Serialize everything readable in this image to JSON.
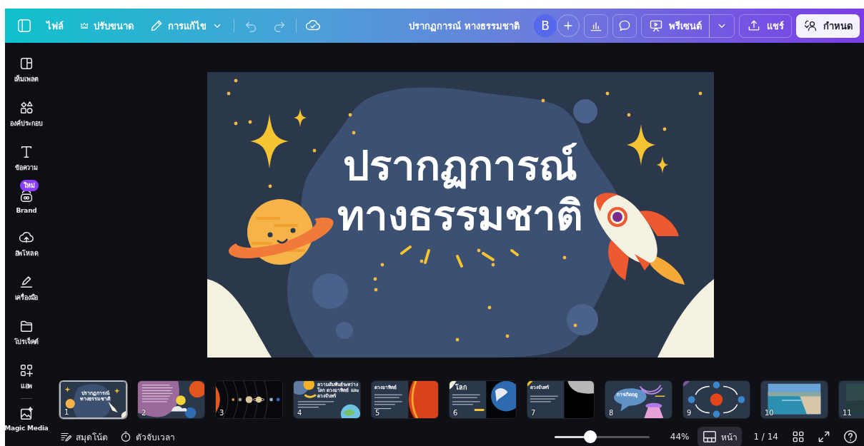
{
  "toolbar": {
    "menu": [
      {
        "label": "ไฟล์",
        "kind": "file"
      },
      {
        "label": "ปรับขนาด",
        "kind": "resize"
      },
      {
        "label": "การแก้ไข",
        "kind": "edit"
      }
    ],
    "title": "ปรากฏการณ์ ทางธรรมชาติ",
    "avatar": "B",
    "present": "พรีเซนต์",
    "share": "แชร์",
    "customize": "กำหนด"
  },
  "sidebar": {
    "items": [
      {
        "label": "เท็มเพลต",
        "kind": "template"
      },
      {
        "label": "องค์ประกอบ",
        "kind": "elements"
      },
      {
        "label": "ข้อความ",
        "kind": "text"
      },
      {
        "label": "Brand",
        "kind": "brand",
        "badge": "ใหม่"
      },
      {
        "label": "อัพโหลด",
        "kind": "upload"
      },
      {
        "label": "เครื่องมือ",
        "kind": "draw"
      },
      {
        "label": "โปรเจ็คต์",
        "kind": "folder"
      },
      {
        "label": "แอพ",
        "kind": "apps"
      },
      {
        "label": "Magic Media",
        "kind": "magic"
      }
    ]
  },
  "slide": {
    "title_lines": [
      "ปรากฏการณ์",
      "ทางธรรมชาติ"
    ]
  },
  "pages": [
    {
      "number": "1",
      "selected": true,
      "kind": "cover",
      "title": "ปรากฏการณ์ ทางธรรมชาติ"
    },
    {
      "number": "2",
      "selected": false,
      "kind": "text-space"
    },
    {
      "number": "3",
      "selected": false,
      "kind": "solar"
    },
    {
      "number": "4",
      "selected": false,
      "kind": "relation",
      "title": "ความสัมพันธ์ระหว่างโลก ดวงอาทิตย์ และดวงจันทร์"
    },
    {
      "number": "5",
      "selected": false,
      "kind": "sun",
      "title": "ดวงอาทิตย์"
    },
    {
      "number": "6",
      "selected": false,
      "kind": "earth",
      "title": "โลก"
    },
    {
      "number": "7",
      "selected": false,
      "kind": "moon",
      "title": "ดวงจันทร์"
    },
    {
      "number": "8",
      "selected": false,
      "kind": "season",
      "title": "การเกิดฤดู"
    },
    {
      "number": "9",
      "selected": false,
      "kind": "orbit"
    },
    {
      "number": "10",
      "selected": false
    },
    {
      "number": "11",
      "selected": false,
      "kind": "photo-dark"
    }
  ],
  "footer": {
    "notes": "สมุดโน้ต",
    "timer": "ตัวจับเวลา",
    "zoom": {
      "level": 0.39
    },
    "zoom_text": "44%",
    "view": "หน้า",
    "page_count": "1 / 14"
  }
}
